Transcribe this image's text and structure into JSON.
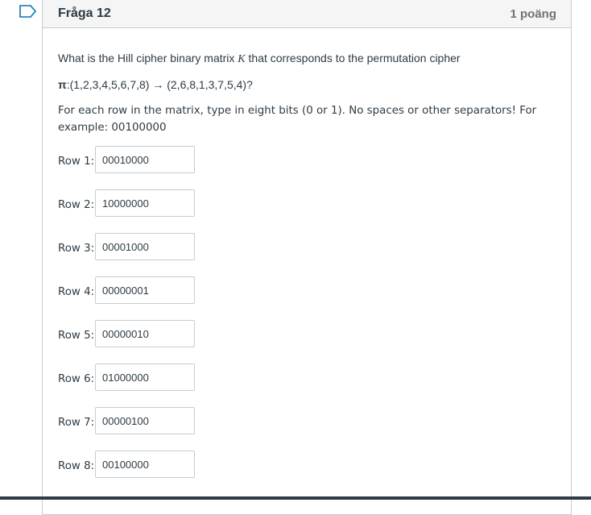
{
  "question": {
    "title": "Fråga 12",
    "points": "1 poäng",
    "flag_icon": "flag-outline-icon",
    "prompt_before_math": "What is the Hill cipher binary matrix ",
    "prompt_math": "K",
    "prompt_after_math": " that corresponds to the permutation cipher",
    "pi_symbol": "π",
    "permutation": ":(1,2,3,4,5,6,7,8) → (2,6,8,1,3,7,5,4)?",
    "instructions": "For each row in the matrix, type in eight bits (0 or 1). No spaces or other separators! For example: 00100000"
  },
  "rows": [
    {
      "label": "Row 1:",
      "value": "00010000"
    },
    {
      "label": "Row 2:",
      "value": "10000000"
    },
    {
      "label": "Row 3:",
      "value": "00001000"
    },
    {
      "label": "Row 4:",
      "value": "00000001"
    },
    {
      "label": "Row 5:",
      "value": "00000010"
    },
    {
      "label": "Row 6:",
      "value": "01000000"
    },
    {
      "label": "Row 7:",
      "value": "00000100"
    },
    {
      "label": "Row 8:",
      "value": "00100000"
    }
  ],
  "colors": {
    "border": "#c7cdd1",
    "header_bg": "#f5f5f5",
    "text": "#2d3b45",
    "points_text": "#6f7479",
    "flag": "#0374b5"
  }
}
